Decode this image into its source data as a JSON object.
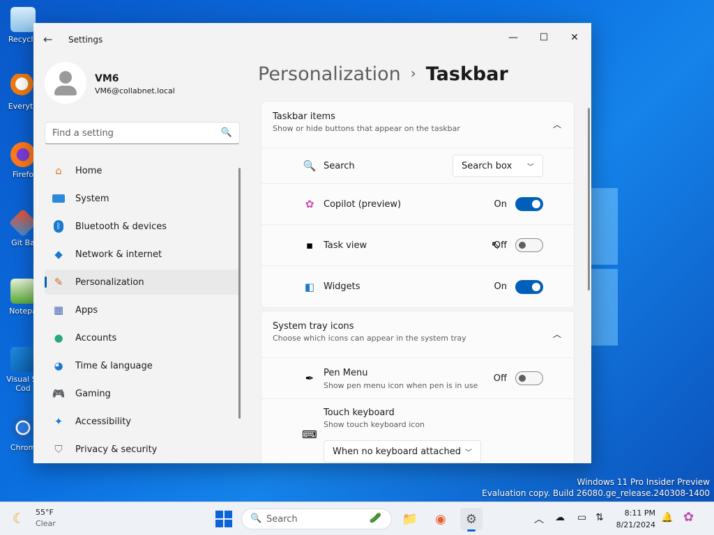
{
  "desktop": {
    "icons": [
      "Recycle",
      "Everyth",
      "Firefo",
      "Git Ba",
      "Notepa",
      "Visual St Cod",
      "Chrom"
    ],
    "watermark_line1": "Windows 11 Pro Insider Preview",
    "watermark_line2": "Evaluation copy. Build 26080.ge_release.240308-1400"
  },
  "window": {
    "title": "Settings",
    "back_icon": "arrow-left-icon",
    "controls": [
      "minimize-icon",
      "maximize-icon",
      "close-icon"
    ]
  },
  "profile": {
    "name": "VM6",
    "email": "VM6@collabnet.local"
  },
  "search": {
    "placeholder": "Find a setting"
  },
  "nav": {
    "items": [
      {
        "label": "Home",
        "icon": "home-icon"
      },
      {
        "label": "System",
        "icon": "monitor-icon"
      },
      {
        "label": "Bluetooth & devices",
        "icon": "bluetooth-icon"
      },
      {
        "label": "Network & internet",
        "icon": "wifi-icon"
      },
      {
        "label": "Personalization",
        "icon": "brush-icon",
        "active": true
      },
      {
        "label": "Apps",
        "icon": "apps-icon"
      },
      {
        "label": "Accounts",
        "icon": "person-icon"
      },
      {
        "label": "Time & language",
        "icon": "globe-clock-icon"
      },
      {
        "label": "Gaming",
        "icon": "gamepad-icon"
      },
      {
        "label": "Accessibility",
        "icon": "accessibility-icon"
      },
      {
        "label": "Privacy & security",
        "icon": "shield-icon"
      }
    ]
  },
  "breadcrumb": {
    "parent": "Personalization",
    "separator": "›",
    "current": "Taskbar"
  },
  "taskbar_items": {
    "title": "Taskbar items",
    "subtitle": "Show or hide buttons that appear on the taskbar",
    "search_label": "Search",
    "search_value": "Search box",
    "copilot_label": "Copilot (preview)",
    "copilot_state": "On",
    "taskview_label": "Task view",
    "taskview_state": "Off",
    "widgets_label": "Widgets",
    "widgets_state": "On"
  },
  "system_tray": {
    "title": "System tray icons",
    "subtitle": "Choose which icons can appear in the system tray",
    "pen_label": "Pen Menu",
    "pen_sub": "Show pen menu icon when pen is in use",
    "pen_state": "Off",
    "touch_label": "Touch keyboard",
    "touch_sub": "Show touch keyboard icon",
    "touch_value": "When no keyboard attached"
  },
  "taskbar": {
    "weather_temp": "55°F",
    "weather_cond": "Clear",
    "search_label": "Search",
    "time": "8:11 PM",
    "date": "8/21/2024"
  },
  "colors": {
    "accent": "#005fb8",
    "desktop": "#0b6fe0"
  }
}
